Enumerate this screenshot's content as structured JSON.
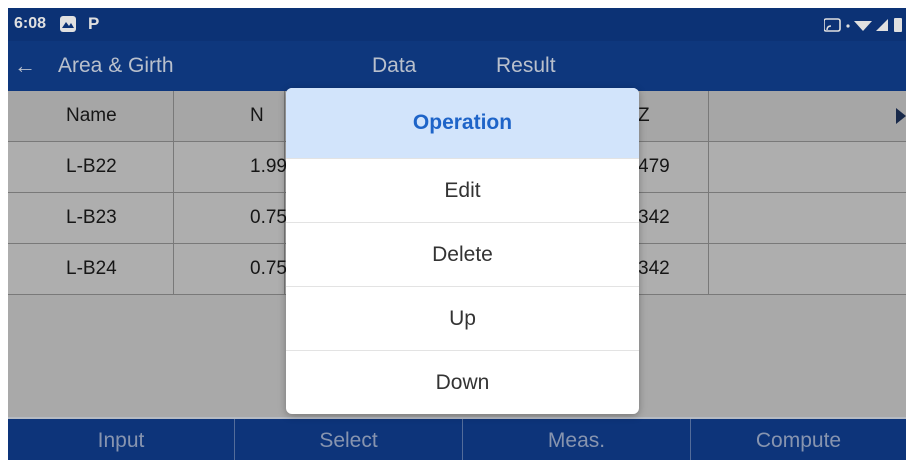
{
  "status": {
    "time": "6:08",
    "p_icon": "P"
  },
  "appbar": {
    "back_icon": "←",
    "title": "Area & Girth",
    "tabs": [
      "Data",
      "Result"
    ]
  },
  "table": {
    "headers": {
      "name": "Name",
      "n": "N",
      "z": "Z"
    },
    "rows": [
      {
        "name": "L-B22",
        "n": "1.99",
        "z": "479"
      },
      {
        "name": "L-B23",
        "n": "0.75",
        "z": "342"
      },
      {
        "name": "L-B24",
        "n": "0.75",
        "z": "342"
      }
    ]
  },
  "dialog": {
    "title": "Operation",
    "items": [
      "Edit",
      "Delete",
      "Up",
      "Down"
    ]
  },
  "bottom": [
    "Input",
    "Select",
    "Meas.",
    "Compute"
  ],
  "colors": {
    "appbar": "#113f8f",
    "dialog_title_bg": "#d2e4fb",
    "dialog_title_text": "#1e64c8"
  }
}
